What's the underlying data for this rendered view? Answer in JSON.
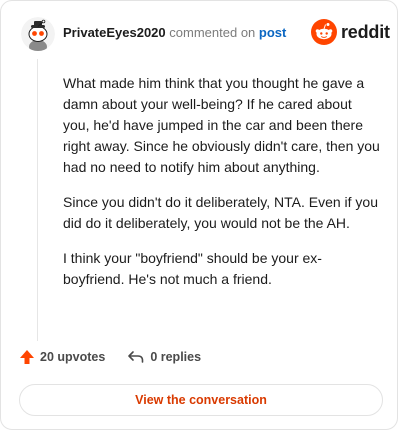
{
  "header": {
    "username": "PrivateEyes2020",
    "action_text": "commented on",
    "post_link": "post",
    "brand_name": "reddit"
  },
  "comment": {
    "paragraphs": [
      "What made him think that you thought he gave a damn about your well-being? If he cared about you, he'd have jumped in the car and been there right away. Since he obviously didn't care, then you had no need to notify him about anything.",
      "Since you didn't do it deliberately, NTA. Even if you did do it deliberately, you would not be the AH.",
      "I think your \"boyfriend\" should be your ex-boyfriend. He's not much a friend."
    ]
  },
  "actions": {
    "upvotes": "20 upvotes",
    "replies": "0 replies"
  },
  "footer": {
    "view_label": "View the conversation"
  },
  "colors": {
    "accent": "#d93a00",
    "link": "#0a66c2",
    "upvote": "#ff4500"
  }
}
